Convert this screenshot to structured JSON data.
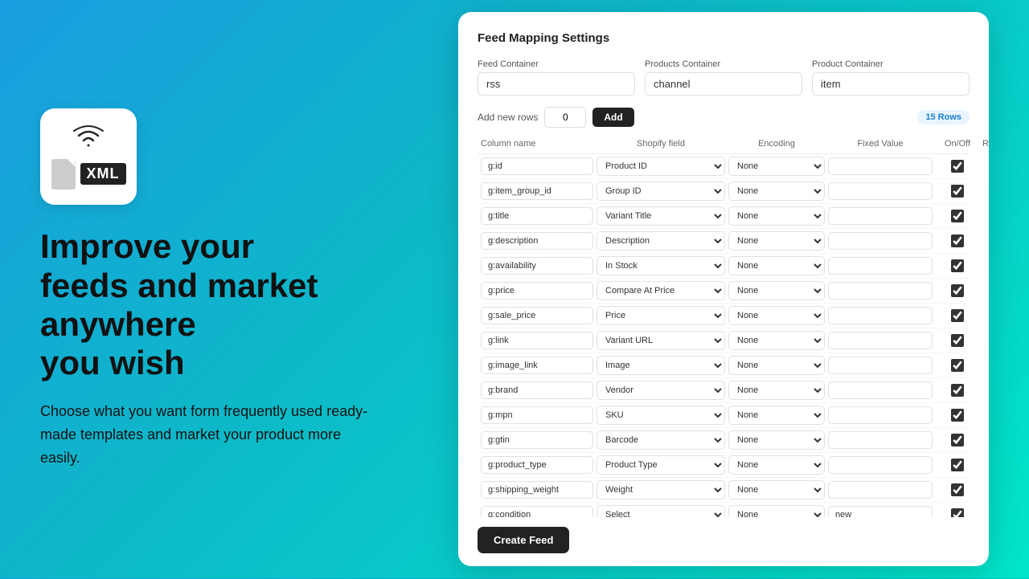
{
  "left": {
    "icon_alt": "XML Feed Tool",
    "headline_line1": "Improve your",
    "headline_line2": "feeds and market",
    "headline_line3": "anywhere",
    "headline_line4": "you wish",
    "subtext": "Choose what you want form frequently used ready-made templates and market your product more easily."
  },
  "card": {
    "title": "Feed Mapping Settings",
    "containers": {
      "feed_label": "Feed Container",
      "feed_value": "rss",
      "products_label": "Products Container",
      "products_value": "channel",
      "product_label": "Product Container",
      "product_value": "item"
    },
    "add_rows": {
      "label": "Add new rows",
      "value": "0",
      "button": "Add",
      "badge": "15 Rows"
    },
    "columns": {
      "headers": [
        "Column name",
        "Shopify field",
        "Encoding",
        "Fixed Value",
        "On/Off",
        "Remove"
      ]
    },
    "rows": [
      {
        "col": "g:id",
        "shopify": "Product ID",
        "encoding": "None",
        "fixed": "",
        "on": true
      },
      {
        "col": "g:item_group_id",
        "shopify": "Group ID",
        "encoding": "None",
        "fixed": "",
        "on": true
      },
      {
        "col": "g:title",
        "shopify": "Variant Title",
        "encoding": "None",
        "fixed": "",
        "on": true
      },
      {
        "col": "g:description",
        "shopify": "Description",
        "encoding": "None",
        "fixed": "",
        "on": true
      },
      {
        "col": "g:availability",
        "shopify": "In Stock",
        "encoding": "None",
        "fixed": "",
        "on": true
      },
      {
        "col": "g:price",
        "shopify": "Compare At Price",
        "encoding": "None",
        "fixed": "",
        "on": true
      },
      {
        "col": "g:sale_price",
        "shopify": "Price",
        "encoding": "None",
        "fixed": "",
        "on": true
      },
      {
        "col": "g:link",
        "shopify": "Variant URL",
        "encoding": "None",
        "fixed": "",
        "on": true
      },
      {
        "col": "g:image_link",
        "shopify": "Image",
        "encoding": "None",
        "fixed": "",
        "on": true
      },
      {
        "col": "g:brand",
        "shopify": "Vendor",
        "encoding": "None",
        "fixed": "",
        "on": true
      },
      {
        "col": "g:mpn",
        "shopify": "SKU",
        "encoding": "None",
        "fixed": "",
        "on": true
      },
      {
        "col": "g:gtin",
        "shopify": "Barcode",
        "encoding": "None",
        "fixed": "",
        "on": true
      },
      {
        "col": "g:product_type",
        "shopify": "Product Type",
        "encoding": "None",
        "fixed": "",
        "on": true
      },
      {
        "col": "g:shipping_weight",
        "shopify": "Weight",
        "encoding": "None",
        "fixed": "",
        "on": true
      },
      {
        "col": "g:condition",
        "shopify": "Select",
        "encoding": "None",
        "fixed": "new",
        "on": true
      }
    ],
    "create_button": "Create Feed"
  }
}
